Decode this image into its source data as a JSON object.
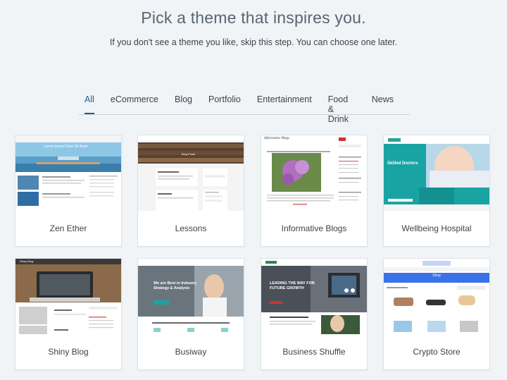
{
  "header": {
    "title": "Pick a theme that inspires you.",
    "subtitle": "If you don't see a theme you like, skip this step. You can choose one later."
  },
  "tabs": [
    {
      "label": "All",
      "active": true
    },
    {
      "label": "eCommerce",
      "active": false
    },
    {
      "label": "Blog",
      "active": false
    },
    {
      "label": "Portfolio",
      "active": false
    },
    {
      "label": "Entertainment",
      "active": false
    },
    {
      "label": "Food & Drink",
      "active": false
    },
    {
      "label": "News",
      "active": false
    }
  ],
  "themes": [
    {
      "name": "Zen Ether",
      "preview_text": "Lorem ipsum Dolor Sit Amet"
    },
    {
      "name": "Lessons",
      "preview_text": "Blog Posts"
    },
    {
      "name": "Informative Blogs",
      "preview_text": "Informative Blogs"
    },
    {
      "name": "Wellbeing Hospital",
      "preview_text": "Skilled Doctors"
    },
    {
      "name": "Shiny Blog",
      "preview_text": "Shiny Blog"
    },
    {
      "name": "Busiway",
      "preview_text": "We are Best in Industry Strategy & Analysis"
    },
    {
      "name": "Business Shuffle",
      "preview_text": "LEADING THE WAY FOR FUTURE GROWTH"
    },
    {
      "name": "Crypto Store",
      "preview_text": "Shop"
    }
  ],
  "colors": {
    "accent": "#1e5c8a",
    "background": "#f0f4f7",
    "teal": "#1aa3a3",
    "blue": "#3a73e8"
  }
}
